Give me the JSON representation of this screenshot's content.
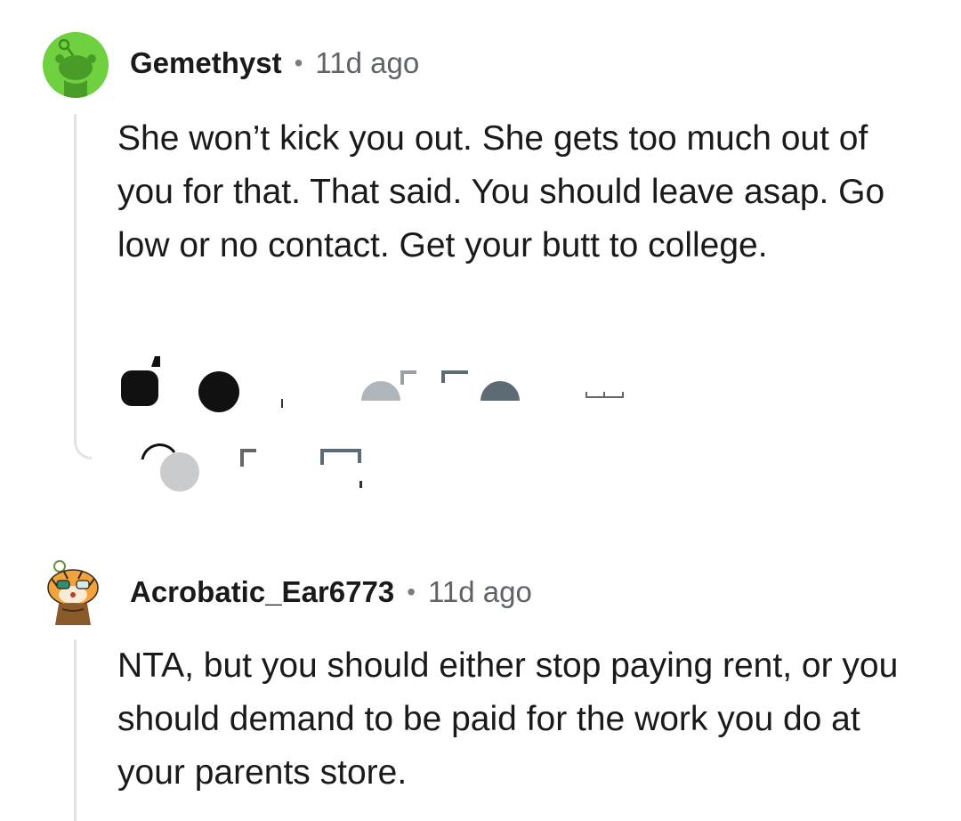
{
  "comments": [
    {
      "username": "Gemethyst",
      "separator": "•",
      "time": "11d ago",
      "body": "She won’t kick you out. She gets too much out of you for that. That said. You should leave asap. Go low or no contact. Get your butt to college.",
      "avatar_icon": "snoo-avatar-icon"
    },
    {
      "username": "Acrobatic_Ear6773",
      "separator": "•",
      "time": "11d ago",
      "body": "NTA, but you should either stop paying rent, or you should demand to be paid for the work you do at your parents store.",
      "avatar_icon": "tiger-avatar-icon"
    }
  ],
  "colors": {
    "avatar_green": "#6fd13f",
    "thread_line": "#e3e3e3",
    "text": "#1a1a1b",
    "meta": "#5f6368"
  }
}
